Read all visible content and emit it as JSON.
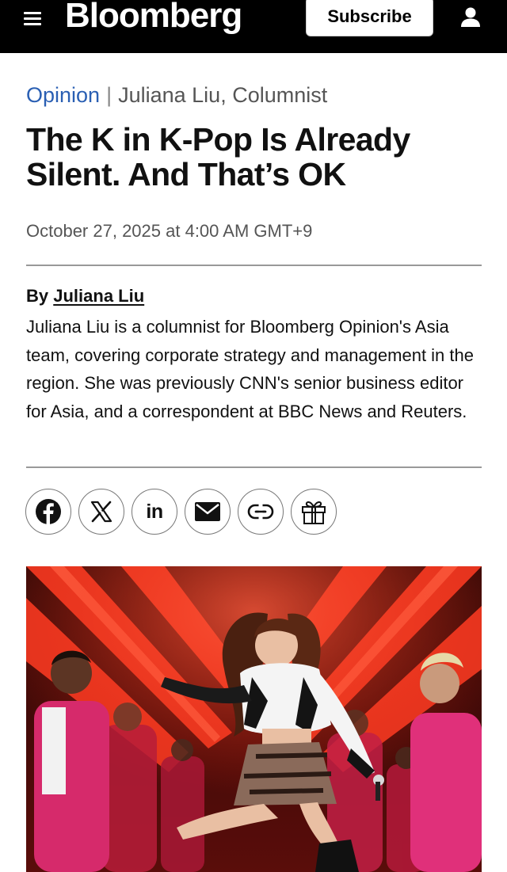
{
  "header": {
    "logo": "Bloomberg",
    "subscribe_label": "Subscribe",
    "menu_icon": "hamburger-icon",
    "account_icon": "user-icon"
  },
  "article": {
    "section": "Opinion",
    "separator": "|",
    "author_role": "Juliana Liu, Columnist",
    "headline": "The K in K-Pop Is Already Silent. And That’s OK",
    "date": "October 27, 2025 at 4:00 AM GMT+9",
    "byline_prefix": "By",
    "author_name": "Juliana Liu",
    "author_bio": "Juliana Liu is a columnist for Bloomberg Opinion's Asia team, covering corporate strategy and management in the region. She was previously CNN's senior business editor for Asia, and a correspondent at BBC News and Reuters."
  },
  "share": {
    "buttons": [
      {
        "icon": "facebook-icon"
      },
      {
        "icon": "x-icon"
      },
      {
        "icon": "linkedin-icon",
        "label": "in"
      },
      {
        "icon": "email-icon"
      },
      {
        "icon": "link-icon"
      },
      {
        "icon": "gift-icon"
      }
    ]
  },
  "hero_image": {
    "description_icon": "concert-photo"
  },
  "colors": {
    "topbar": "#000000",
    "section_link": "#2a5fb3",
    "stage_red": "#d8321f"
  }
}
